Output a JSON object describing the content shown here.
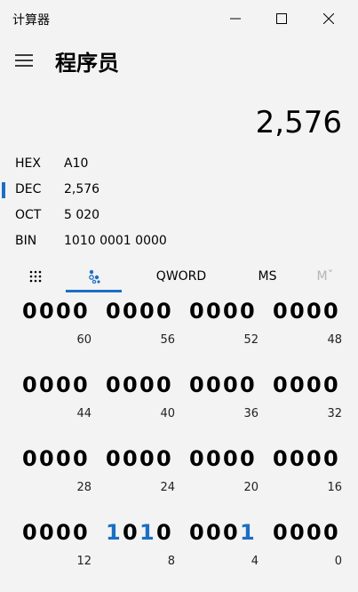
{
  "window": {
    "title": "计算器"
  },
  "header": {
    "mode_title": "程序员"
  },
  "display": {
    "value": "2,576"
  },
  "bases": [
    {
      "label": "HEX",
      "value": "A10",
      "selected": false
    },
    {
      "label": "DEC",
      "value": "2,576",
      "selected": true
    },
    {
      "label": "OCT",
      "value": "5 020",
      "selected": false
    },
    {
      "label": "BIN",
      "value": "1010 0001 0000",
      "selected": false
    }
  ],
  "keypad_bar": {
    "full_keypad_icon": "keypad-grid-icon",
    "bit_toggle_icon": "bit-toggle-icon",
    "word_size": "QWORD",
    "memory_store": "MS",
    "memory_recall": "Mˇ"
  },
  "bit_groups": [
    {
      "bits": [
        "0",
        "0",
        "0",
        "0"
      ],
      "on": [
        false,
        false,
        false,
        false
      ],
      "position": "60"
    },
    {
      "bits": [
        "0",
        "0",
        "0",
        "0"
      ],
      "on": [
        false,
        false,
        false,
        false
      ],
      "position": "56"
    },
    {
      "bits": [
        "0",
        "0",
        "0",
        "0"
      ],
      "on": [
        false,
        false,
        false,
        false
      ],
      "position": "52"
    },
    {
      "bits": [
        "0",
        "0",
        "0",
        "0"
      ],
      "on": [
        false,
        false,
        false,
        false
      ],
      "position": "48"
    },
    {
      "bits": [
        "0",
        "0",
        "0",
        "0"
      ],
      "on": [
        false,
        false,
        false,
        false
      ],
      "position": "44"
    },
    {
      "bits": [
        "0",
        "0",
        "0",
        "0"
      ],
      "on": [
        false,
        false,
        false,
        false
      ],
      "position": "40"
    },
    {
      "bits": [
        "0",
        "0",
        "0",
        "0"
      ],
      "on": [
        false,
        false,
        false,
        false
      ],
      "position": "36"
    },
    {
      "bits": [
        "0",
        "0",
        "0",
        "0"
      ],
      "on": [
        false,
        false,
        false,
        false
      ],
      "position": "32"
    },
    {
      "bits": [
        "0",
        "0",
        "0",
        "0"
      ],
      "on": [
        false,
        false,
        false,
        false
      ],
      "position": "28"
    },
    {
      "bits": [
        "0",
        "0",
        "0",
        "0"
      ],
      "on": [
        false,
        false,
        false,
        false
      ],
      "position": "24"
    },
    {
      "bits": [
        "0",
        "0",
        "0",
        "0"
      ],
      "on": [
        false,
        false,
        false,
        false
      ],
      "position": "20"
    },
    {
      "bits": [
        "0",
        "0",
        "0",
        "0"
      ],
      "on": [
        false,
        false,
        false,
        false
      ],
      "position": "16"
    },
    {
      "bits": [
        "0",
        "0",
        "0",
        "0"
      ],
      "on": [
        false,
        false,
        false,
        false
      ],
      "position": "12"
    },
    {
      "bits": [
        "1",
        "0",
        "1",
        "0"
      ],
      "on": [
        true,
        false,
        true,
        false
      ],
      "position": "8"
    },
    {
      "bits": [
        "0",
        "0",
        "0",
        "1"
      ],
      "on": [
        false,
        false,
        false,
        true
      ],
      "position": "4"
    },
    {
      "bits": [
        "0",
        "0",
        "0",
        "0"
      ],
      "on": [
        false,
        false,
        false,
        false
      ],
      "position": "0"
    }
  ],
  "colors": {
    "accent": "#1a6fc4",
    "background": "#f3f3f3"
  }
}
